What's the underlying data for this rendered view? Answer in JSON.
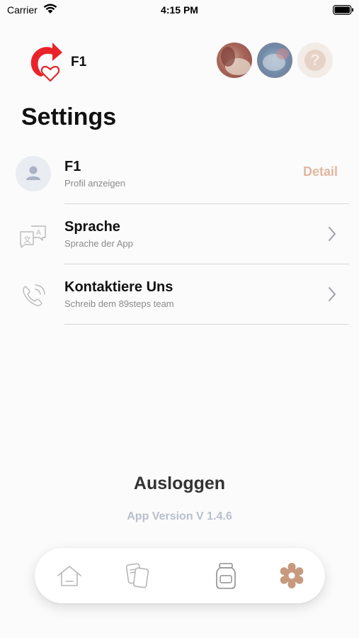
{
  "status_bar": {
    "carrier": "Carrier",
    "time": "4:15 PM"
  },
  "header": {
    "profile_name": "F1",
    "avatar_help_glyph": "?"
  },
  "page": {
    "title": "Settings"
  },
  "rows": [
    {
      "title": "F1",
      "subtitle": "Profil anzeigen",
      "action": "Detail",
      "icon": "user-avatar-icon"
    },
    {
      "title": "Sprache",
      "subtitle": "Sprache der App",
      "icon": "translate-icon"
    },
    {
      "title": "Kontaktiere Uns",
      "subtitle": "Schreib dem 89steps team",
      "icon": "phone-icon"
    }
  ],
  "footer": {
    "logout": "Ausloggen",
    "version": "App Version V 1.4.6"
  },
  "tabbar": {
    "tabs": [
      {
        "icon": "home-icon",
        "active": false
      },
      {
        "icon": "cards-icon",
        "active": false
      },
      {
        "icon": "jar-icon",
        "active": false
      },
      {
        "icon": "gear-icon",
        "active": true
      }
    ]
  },
  "colors": {
    "accent": "#c79a7e",
    "detail": "#e2b6a0",
    "logo_red": "#e8242a",
    "muted_icon": "#b9b9b9",
    "version": "#b7bfcc"
  }
}
